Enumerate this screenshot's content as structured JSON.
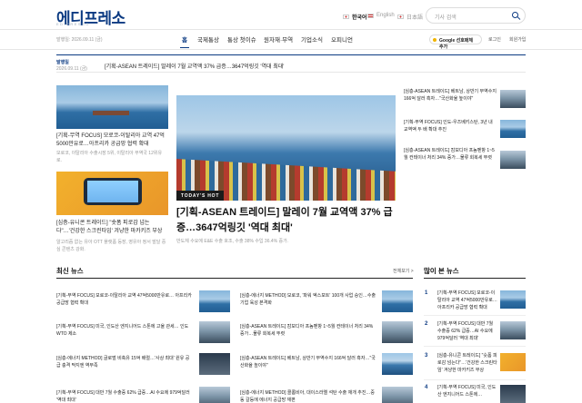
{
  "header": {
    "logo": "에디프레소",
    "logo_sub": "EDIPRESSO",
    "languages": [
      {
        "label": "한국어",
        "active": true
      },
      {
        "label": "English",
        "active": false
      },
      {
        "label": "日本語",
        "active": false
      }
    ],
    "search_placeholder": "기사 검색",
    "date_line": "발행일: 2026.09.11 (금)"
  },
  "nav": {
    "items": [
      "홈",
      "국제통상",
      "통상 첫이슈",
      "원자재·무역",
      "기업소식",
      "오피니언"
    ],
    "google_btn": "Google 선호매체 추가",
    "login": "로그인",
    "signup": "회원가입"
  },
  "breaking": {
    "label": "발행일",
    "date": "2026.09.11 (금)",
    "title": "[기획-ASEAN 트레이드] 말레이 7월 교역액 37% 급증…3647억링깃 '역대 최대'"
  },
  "left_col": {
    "story1": {
      "title": "[기획-무역 FOCUS] 모로코-이탈리아 교역 47억5000만유로…아프리카 공급망 협력 확대",
      "summary": "모로코, 이탈리아 수출시장 5위, 이탈리아 무역국 12위유로."
    },
    "story2": {
      "title": "[심층-유니콘 트레이드] \"숏폼 피로감 넘는다\"…'건강한 스크린타임' 겨냥한 마카키즈 부상",
      "summary": "알고리즘 없는 유아 OTT 플랫폼 등장, 영유아 정서 발달 중심 콘텐츠 강화."
    }
  },
  "center": {
    "badge": "TODAY'S HOT",
    "title": "[기획-ASEAN 트레이드] 말레이 7월 교역액 37% 급증…3647억링깃 '역대 최대'",
    "summary": "반도체 수요에 E&E 수출 호조, 수출 38% 수입 36.4% 증가."
  },
  "right_col": [
    "[심층-ASEAN 트레이드] 베트남, 상반기 무역수지 166억 달러 흑자…\"국산화율 높이야\"",
    "[기획-무역 FOCUS] 인도-우즈베키스탄, 3년 내 교역액 두 배 확대 추진",
    "[심층-ASEAN 트레이드] 캄보디아 프놈펜항 1~5월 컨테이너 처리 34% 증가…물류 회복세 뚜렷"
  ],
  "latest": {
    "heading": "최신 뉴스",
    "more": "전체보기 >",
    "col1": [
      "[기획-무역 FOCUS] 모로코-이탈리아 교역 47억5000만유로… 아프리카 공급망 협력 확대",
      "[기획-무역 FOCUS] 미국, 인도산 엔지니어드 스톤에 고율 관세… 인도 WTO 제소",
      "[심층-에너지 METHOD] 글로벌 비축유 15억 배럴…'사상 최대' 원유 공급 충격 막지엔 역부족",
      "[기획-무역 FOCUS] 대만 7월 수출증 62% 급증…AI 수요에 979억달러 '역대 최대'"
    ],
    "col2": [
      "[심층-에너지 METHOD] 모로코, '파워 엑스포트' 100개 사업 승인…수출기업 육성 본격화",
      "[심층-ASEAN 트레이드] 캄보디아 프놈펜항 1~5월 컨테이너 처리 34% 증가…물류 회복세 뚜렷",
      "[심층-ASEAN 트레이드] 베트남, 상반기 무역수지 166억 달러 흑자…\"국산화율 높이야\"",
      "[심층-에너지 METHOD] 콜롬비아, 대이스라엘 석탄 수출 재개 추진…중동 갈등에 에너지 공급망 재편"
    ]
  },
  "popular": {
    "heading": "많이 본 뉴스",
    "items": [
      {
        "rank": "1",
        "title": "[기획-무역 FOCUS] 모로코-이탈리아 교역 47억5000만유로…아프리카 공급망 협력 확대"
      },
      {
        "rank": "2",
        "title": "[기획-무역 FOCUS] 대만 7월 수출증 62% 급증…AI 수요에 979억달러 '역대 최대'"
      },
      {
        "rank": "3",
        "title": "[심층-유니콘 트레이드] \"숏폼 피로감 넘는다\"…'건강한 스크린타임' 겨냥한 마카키즈 부상"
      },
      {
        "rank": "4",
        "title": "[기획-무역 FOCUS] 미국, 인도산 엔지니어드 스톤에…"
      }
    ]
  }
}
